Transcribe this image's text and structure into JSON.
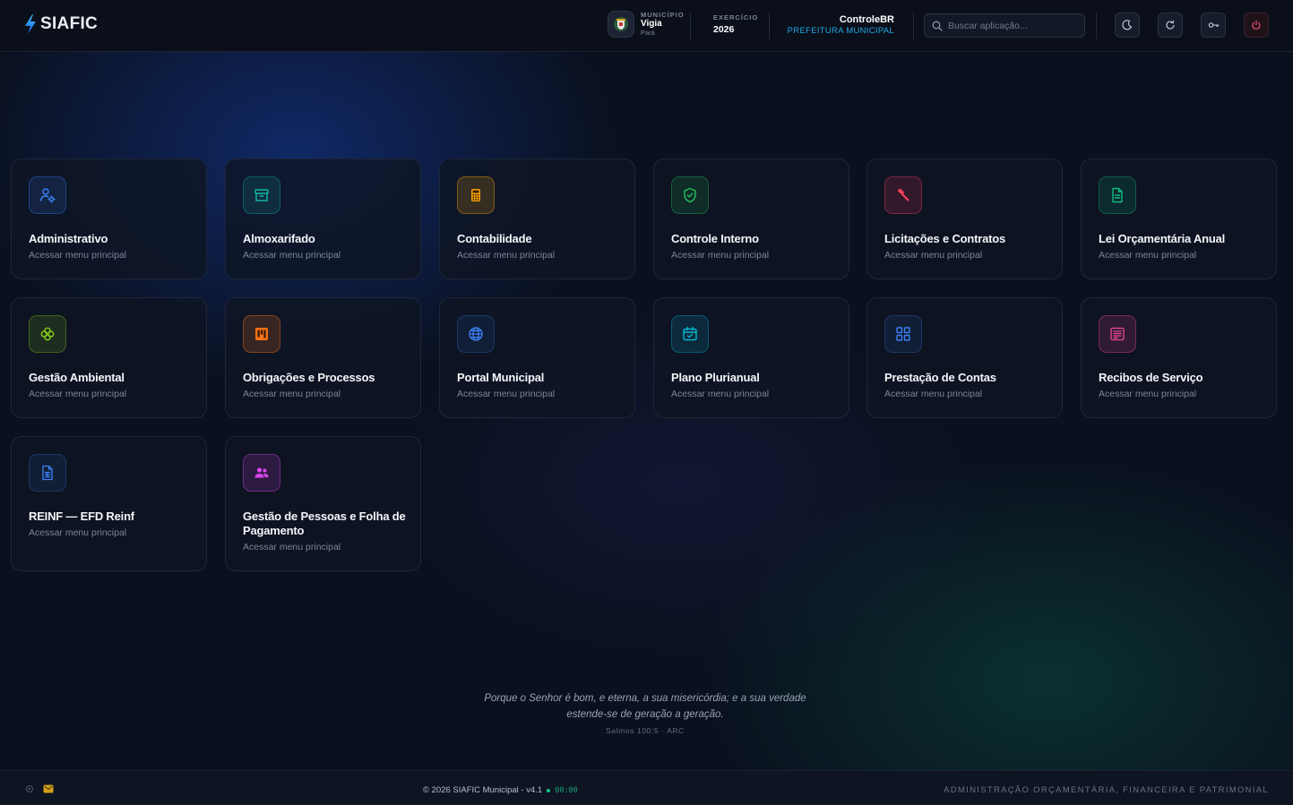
{
  "header": {
    "brand": "SIAFIC",
    "municipio_label": "MUNICÍPIO",
    "municipio_name": "Vigia",
    "municipio_state": "Pará",
    "exercicio_label": "EXERCÍCIO",
    "exercicio_value": "2026",
    "org_name": "ControleBR",
    "org_sub": "PREFEITURA MUNICIPAL",
    "search_placeholder": "Buscar aplicação..."
  },
  "modules": [
    {
      "title": "Administrativo",
      "subtitle": "Acessar menu principal",
      "icon": "user-gear-icon",
      "color": "#3b82f6"
    },
    {
      "title": "Almoxarifado",
      "subtitle": "Acessar menu principal",
      "icon": "archive-box-icon",
      "color": "#14b8a6"
    },
    {
      "title": "Contabilidade",
      "subtitle": "Acessar menu principal",
      "icon": "calculator-icon",
      "color": "#f59e0b"
    },
    {
      "title": "Controle Interno",
      "subtitle": "Acessar menu principal",
      "icon": "shield-check-icon",
      "color": "#22c55e"
    },
    {
      "title": "Licitações e Contratos",
      "subtitle": "Acessar menu principal",
      "icon": "gavel-icon",
      "color": "#f43f5e"
    },
    {
      "title": "Lei Orçamentária Anual",
      "subtitle": "Acessar menu principal",
      "icon": "document-icon",
      "color": "#10b981"
    },
    {
      "title": "Gestão Ambiental",
      "subtitle": "Acessar menu principal",
      "icon": "clover-icon",
      "color": "#84cc16"
    },
    {
      "title": "Obrigações e Processos",
      "subtitle": "Acessar menu principal",
      "icon": "kanban-icon",
      "color": "#f97316"
    },
    {
      "title": "Portal Municipal",
      "subtitle": "Acessar menu principal",
      "icon": "globe-icon",
      "color": "#3b82f6"
    },
    {
      "title": "Plano Plurianual",
      "subtitle": "Acessar menu principal",
      "icon": "calendar-check-icon",
      "color": "#06b6d4"
    },
    {
      "title": "Prestação de Contas",
      "subtitle": "Acessar menu principal",
      "icon": "grid-icon",
      "color": "#3b82f6"
    },
    {
      "title": "Recibos de Serviço",
      "subtitle": "Acessar menu principal",
      "icon": "receipt-icon",
      "color": "#ec4899"
    },
    {
      "title": "REINF — EFD Reinf",
      "subtitle": "Acessar menu principal",
      "icon": "file-lines-icon",
      "color": "#3b82f6"
    },
    {
      "title": "Gestão de Pessoas e Folha de Pagamento",
      "subtitle": "Acessar menu principal",
      "icon": "users-icon",
      "color": "#d946ef"
    }
  ],
  "quote": {
    "text": "Porque o Senhor é bom, e eterna, a sua misericórdia; e a sua verdade estende-se de geração a geração.",
    "reference": "Salmos 100:5 · ARC"
  },
  "footer": {
    "copyright": "© 2026 SIAFIC Municipal - v4.1",
    "clock": "00:00",
    "tagline": "ADMINISTRAÇÃO ORÇAMENTÁRIA, FINANCEIRA E PATRIMONIAL"
  }
}
